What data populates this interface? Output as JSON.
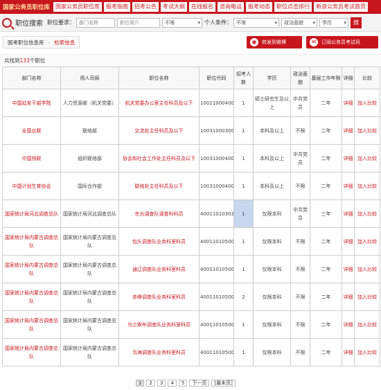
{
  "topnav": {
    "brand": "国家公务员职位库",
    "items": [
      "国家公务员职位库",
      "报考指南",
      "招考公告",
      "考试大纲",
      "在线报名",
      "咨询电话",
      "报考动态",
      "职位点击排行",
      "新浪公务员考试首页"
    ]
  },
  "search": {
    "title": "职位搜索",
    "req_label": "职位要求：",
    "dept_placeholder": "部门名称",
    "brief_placeholder": "职位简介",
    "limit_select": "不限",
    "personal_label": "个人条件：",
    "personal_select": "不限",
    "politics_select": "政治面貌",
    "edu_select": "学历",
    "btn": "搜"
  },
  "crumb": {
    "home": "国考职位信息库",
    "sep": "-",
    "current": "检索信息"
  },
  "actions": {
    "weibo": "转发到微博",
    "subscribe": "订阅公务员考试讯"
  },
  "count": {
    "prefix": "共找到",
    "number": "133",
    "suffix": "个职位"
  },
  "table": {
    "headers": [
      "部门名称",
      "用人司局",
      "职位名称",
      "职位代码",
      "招考人数",
      "学历",
      "政治面貌",
      "基层工作年限",
      "详细",
      "比较"
    ],
    "rows": [
      {
        "dept": "中国延安干部学院",
        "bureau": "人力资源部（机关党委）",
        "position": "机关党委办公室主任科员及以下",
        "code": "100210004006",
        "num": "1",
        "edu": "硕士研究生及以上",
        "politics": "中共党员",
        "years": "二年",
        "detail": "详细",
        "compare": "加入比较"
      },
      {
        "dept": "全国台联",
        "bureau": "联络部",
        "position": "交流处主任科员及以下",
        "code": "100310003005",
        "num": "1",
        "edu": "本科及以上",
        "politics": "不限",
        "years": "二年",
        "detail": "详细",
        "compare": "加入比较"
      },
      {
        "dept": "中国残联",
        "bureau": "组织联络部",
        "position": "协会和社会工作处主任科员及以下",
        "code": "100310004004",
        "num": "1",
        "edu": "本科及以上",
        "politics": "中共党员",
        "years": "二年",
        "detail": "详细",
        "compare": "加入比较"
      },
      {
        "dept": "中国计划生育协会",
        "bureau": "国际合作部",
        "position": "联络处主任科员及以下",
        "code": "100310004003",
        "num": "1",
        "edu": "本科及以上",
        "politics": "不限",
        "years": "二年",
        "detail": "详细",
        "compare": "加入比较"
      },
      {
        "dept": "国家统计局河北调查总队",
        "bureau": "国家统计局河北调查总队",
        "position": "东光调查队调查科科员",
        "code": "400110103037",
        "num": "1",
        "edu": "仅限本科",
        "politics": "中共党员",
        "years": "三年",
        "detail": "详细",
        "compare": "加入比较"
      },
      {
        "dept": "国家统计局内蒙古调查总队",
        "bureau": "国家统计局内蒙古调查总队",
        "position": "包头调查队业务科室科员",
        "code": "400110105002",
        "num": "1",
        "edu": "仅限本科",
        "politics": "不限",
        "years": "二年",
        "detail": "详细",
        "compare": "加入比较"
      },
      {
        "dept": "国家统计局内蒙古调查总队",
        "bureau": "国家统计局内蒙古调查总队",
        "position": "通辽调查队业务科室科员",
        "code": "400110105003",
        "num": "1",
        "edu": "仅限本科",
        "politics": "不限",
        "years": "二年",
        "detail": "详细",
        "compare": "加入比较"
      },
      {
        "dept": "国家统计局内蒙古调查总队",
        "bureau": "国家统计局内蒙古调查总队",
        "position": "赤峰调查队业务科室科员",
        "code": "400110105004",
        "num": "2",
        "edu": "仅限本科",
        "politics": "不限",
        "years": "二年",
        "detail": "详细",
        "compare": "加入比较"
      },
      {
        "dept": "国家统计局内蒙古调查总队",
        "bureau": "国家统计局内蒙古调查总队",
        "position": "乌兰察布调查队业务科室科员",
        "code": "400110105005",
        "num": "1",
        "edu": "仅限本科",
        "politics": "不限",
        "years": "二年",
        "detail": "详细",
        "compare": "加入比较"
      },
      {
        "dept": "国家统计局内蒙古调查总队",
        "bureau": "国家统计局内蒙古调查总队",
        "position": "乌海调查队业务科室科员",
        "code": "400110105007",
        "num": "1",
        "edu": "仅限本科",
        "politics": "不限",
        "years": "二年",
        "detail": "详细",
        "compare": "加入比较"
      }
    ]
  },
  "pager": {
    "pages": [
      "1",
      "2",
      "3",
      "4",
      "5"
    ],
    "next": "下一页",
    "last": "[最末页]"
  }
}
